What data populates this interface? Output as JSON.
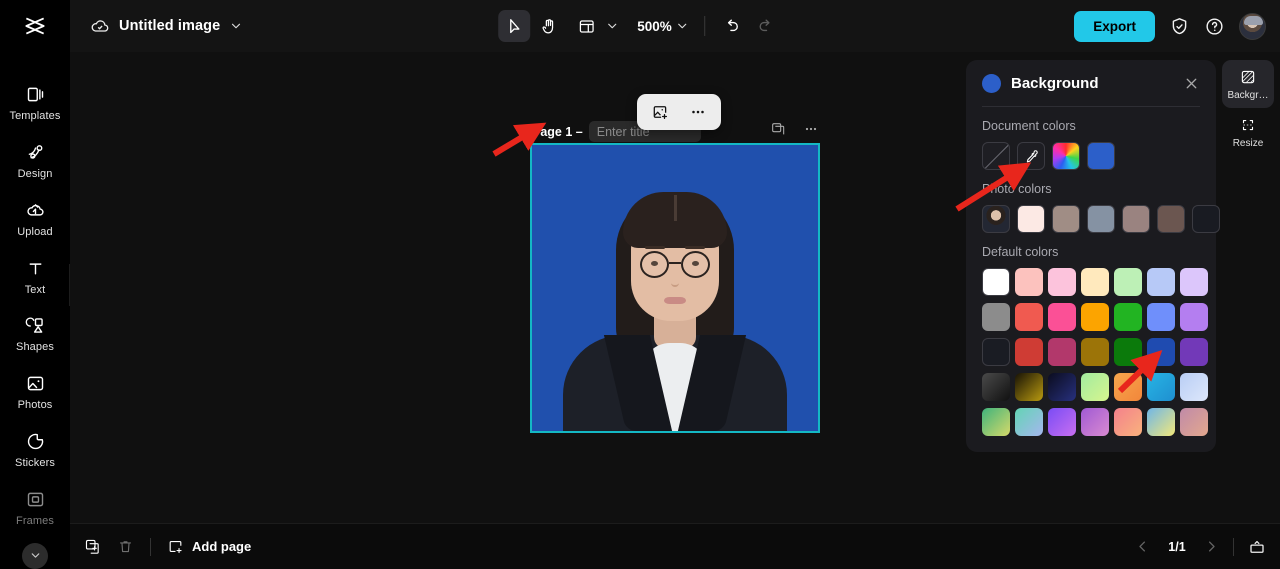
{
  "app": {
    "logo": "capcut-logo",
    "document_title": "Untitled image",
    "cloud_status_icon": "cloud-saved-icon"
  },
  "toolbar": {
    "select_tool": "select-tool",
    "hand_tool": "hand-tool",
    "layout_tool": "layout-tool",
    "zoom_level": "500%",
    "undo": "undo",
    "redo": "redo",
    "export_label": "Export",
    "shield_icon": "shield-icon",
    "help_icon": "help-icon",
    "avatar": "user-avatar"
  },
  "sidebar": {
    "items": [
      {
        "label": "Templates",
        "icon": "templates-icon"
      },
      {
        "label": "Design",
        "icon": "design-icon"
      },
      {
        "label": "Upload",
        "icon": "upload-icon"
      },
      {
        "label": "Text",
        "icon": "text-icon"
      },
      {
        "label": "Shapes",
        "icon": "shapes-icon"
      },
      {
        "label": "Photos",
        "icon": "photos-icon"
      },
      {
        "label": "Stickers",
        "icon": "stickers-icon"
      },
      {
        "label": "Frames",
        "icon": "frames-icon"
      }
    ],
    "more_icon": "chevron-down-icon",
    "collapse_icon": "chevron-right-icon"
  },
  "canvas": {
    "page_label": "Page 1 –",
    "page_title_placeholder": "Enter title",
    "page_title_value": "",
    "duplicate_page_icon": "duplicate-page-icon",
    "page_more_icon": "more-options-icon",
    "floating_toolbar": {
      "replace_image_icon": "replace-image-icon",
      "more_icon": "more-options-icon"
    },
    "artboard": {
      "background_color": "#2050ad",
      "selection_color": "#14b8c4"
    }
  },
  "panel": {
    "title": "Background",
    "current_color": "#2c5fc9",
    "close_icon": "close-icon",
    "sections": [
      {
        "label": "Document colors"
      },
      {
        "label": "Photo colors"
      },
      {
        "label": "Default colors"
      }
    ],
    "document_colors": [
      {
        "name": "no-color",
        "type": "none"
      },
      {
        "name": "eyedropper",
        "type": "picker"
      },
      {
        "name": "color-wheel",
        "type": "wheel"
      },
      {
        "name": "blue",
        "type": "solid",
        "color": "#2c5fc9"
      }
    ],
    "photo_colors": [
      {
        "name": "photo-thumbnail",
        "type": "avatar"
      },
      {
        "name": "blush-white",
        "type": "solid",
        "color": "#fce9e4"
      },
      {
        "name": "warm-taupe",
        "type": "solid",
        "color": "#a08d85"
      },
      {
        "name": "slate-grey",
        "type": "solid",
        "color": "#8592a3"
      },
      {
        "name": "mauve-brown",
        "type": "solid",
        "color": "#9a8380"
      },
      {
        "name": "dark-brown",
        "type": "solid",
        "color": "#6b5650"
      },
      {
        "name": "near-black",
        "type": "solid",
        "color": "#191b22"
      }
    ],
    "default_colors": [
      [
        "#ffffff",
        "#fcc2be",
        "#fcc3dc",
        "#ffe9bd",
        "#bdf0b6",
        "#b7c9f7",
        "#dcc6fb"
      ],
      [
        "#8c8c8c",
        "#f05a50",
        "#fb5096",
        "#fca400",
        "#22b422",
        "#6f8ffb",
        "#b47ef0"
      ],
      [
        "#1a1c23",
        "#cf3c34",
        "#b2386b",
        "#9c7408",
        "#0b7a0b",
        "#1f4bb0",
        "#7239b8"
      ],
      [
        "#3c3c3c",
        "#8f7a0a",
        "#161b5e",
        "#a6efa0",
        "#f79c4a",
        "#28a7dd",
        "#c6d8f7"
      ],
      [
        "#4fbf7e",
        "#6fd3c0",
        "#8a50f5",
        "#b05fcf",
        "#f38a90",
        "#6fb3e8",
        "#c08aa8"
      ]
    ],
    "default_colors_gradients": {
      "r4c1": "linear-gradient(135deg,#4a4a4a,#111111)",
      "r4c2": "linear-gradient(135deg,#171206,#b99a10)",
      "r4c3": "linear-gradient(135deg,#0b0c1e,#27307e)",
      "r4c4": "linear-gradient(135deg,#a2eba0,#d7f58e)",
      "r4c5": "linear-gradient(135deg,#f7a64d,#f2863a)",
      "r4c6": "linear-gradient(135deg,#27b4e4,#1f8fd0)",
      "r4c7": "linear-gradient(135deg,#b9cef5,#dde7fb)",
      "r5c1": "linear-gradient(135deg,#3fb37c,#d5d96a)",
      "r5c2": "linear-gradient(135deg,#63d4b4,#a5b7ee)",
      "r5c3": "linear-gradient(135deg,#7a4cf5,#c86ff0)",
      "r5c4": "linear-gradient(135deg,#a05ad4,#d98ad1)",
      "r5c5": "linear-gradient(135deg,#f4818c,#f9b27d)",
      "r5c6": "linear-gradient(135deg,#6fb6e8,#f2e87a)",
      "r5c7": "linear-gradient(135deg,#c08aa8,#e3a88e)"
    }
  },
  "minirail": {
    "items": [
      {
        "label": "Backgr…",
        "icon": "background-icon",
        "active": true
      },
      {
        "label": "Resize",
        "icon": "resize-icon",
        "active": false
      }
    ]
  },
  "bottombar": {
    "duplicate_icon": "duplicate-icon",
    "delete_icon": "trash-icon",
    "add_page_label": "Add page",
    "add_page_icon": "add-page-icon",
    "prev_icon": "chevron-left-icon",
    "page_count": "1/1",
    "next_icon": "chevron-right-icon",
    "presentation_icon": "presentation-icon"
  },
  "annotations": {
    "color": "#e8261c",
    "arrows": [
      {
        "name": "arrow-to-page-label"
      },
      {
        "name": "arrow-to-eyedropper"
      },
      {
        "name": "arrow-to-dark-blue-swatch"
      }
    ]
  }
}
